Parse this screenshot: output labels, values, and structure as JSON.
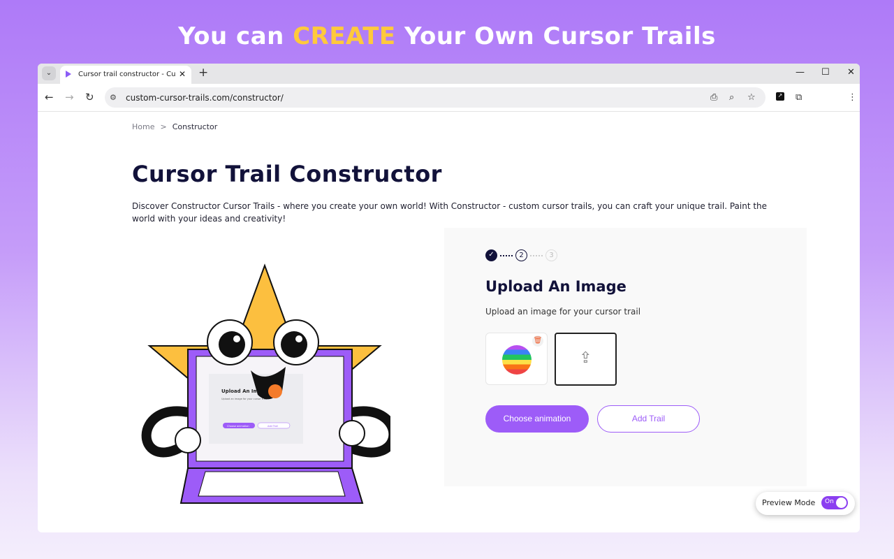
{
  "banner": {
    "pre": "You can ",
    "highlight": "CREATE",
    "post": " Your Own Cursor Trails"
  },
  "browser": {
    "tab_title": "Cursor trail constructor - Custom Cursor",
    "url": "custom-cursor-trails.com/constructor/"
  },
  "breadcrumb": {
    "home": "Home",
    "separator": ">",
    "current": "Constructor"
  },
  "page": {
    "title": "Cursor Trail Constructor",
    "description": "Discover Constructor Cursor Trails - where you create your own world! With Constructor - custom cursor trails, you can craft your unique trail. Paint the world with your ideas and creativity!"
  },
  "steps": {
    "current": 2,
    "items": [
      "✓",
      "2",
      "3"
    ]
  },
  "panel": {
    "title": "Upload An Image",
    "subtitle": "Upload an image for your cursor trail",
    "choose_label": "Choose animation",
    "add_label": "Add Trail"
  },
  "illustration": {
    "screen_title": "Upload An Image",
    "screen_sub": "Upload an image for your cursor trail",
    "screen_btn1": "Choose animation",
    "screen_btn2": "Add Trail"
  },
  "preview": {
    "label": "Preview Mode",
    "toggle": "On",
    "enabled": true
  },
  "colors": {
    "accent": "#9d5cf8",
    "heading": "#12123a",
    "highlight": "#ffc93c"
  }
}
